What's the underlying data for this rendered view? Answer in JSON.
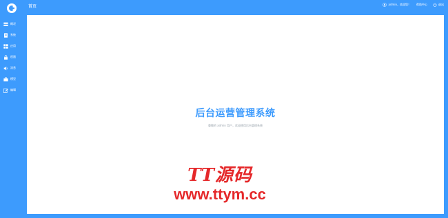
{
  "colors": {
    "accent": "#3d9bfd",
    "panel": "#ffffff",
    "watermark": "#e5282a"
  },
  "header": {
    "title": "首页",
    "user": "admin，欢迎您！",
    "help": "帮助中心",
    "logout": "退出"
  },
  "sidebar": {
    "items": [
      {
        "label": "概况",
        "icon": "overview-icon"
      },
      {
        "label": "系统",
        "icon": "document-icon"
      },
      {
        "label": "应用",
        "icon": "apps-grid-icon"
      },
      {
        "label": "权限",
        "icon": "lock-icon"
      },
      {
        "label": "消息",
        "icon": "speaker-icon"
      },
      {
        "label": "模型",
        "icon": "briefcase-icon"
      },
      {
        "label": "编辑",
        "icon": "edit-icon"
      }
    ]
  },
  "main": {
    "system_title": "后台运营管理系统",
    "welcome_text": "尊敬的 admin 用户，欢迎使用后台管理系统",
    "watermark_logo": "TT源码",
    "watermark_url": "www.ttym.cc"
  }
}
